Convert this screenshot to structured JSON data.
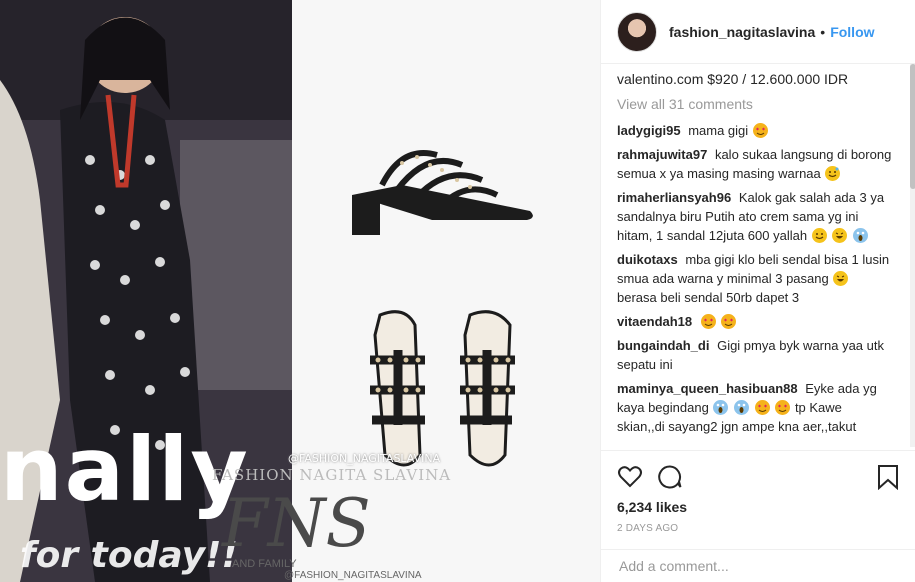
{
  "post": {
    "overlay_main": "nally",
    "overlay_bottom": "for today!!",
    "watermark_handle": "@FASHION_NAGITASLAVINA",
    "watermark_name": "FASHION NAGITA SLAVINA",
    "watermark_logo": "FNS",
    "watermark_family": "AND FAMILY",
    "watermark_handle2": "@FASHION_NAGITASLAVINA"
  },
  "header": {
    "username": "fashion_nagitaslavina",
    "separator": "•",
    "follow_label": "Follow"
  },
  "caption": "valentino.com $920 / 12.600.000 IDR",
  "view_all": "View all 31 comments",
  "comments": [
    {
      "user": "ladygigi95",
      "text": "mama gigi"
    },
    {
      "user": "rahmajuwita97",
      "text": "kalo sukaa langsung di borong semua x ya masing masing warnaa"
    },
    {
      "user": "rimaherliansyah96",
      "text": "Kalok gak salah ada 3 ya sandalnya biru Putih ato crem sama yg ini hitam, 1 sandal 12juta 600 yallah"
    },
    {
      "user": "duikotaxs",
      "text": "mba gigi klo beli sendal bisa 1 lusin smua ada warna y minimal 3 pasang",
      "text2": "berasa beli sendal 50rb dapet 3"
    },
    {
      "user": "vitaendah18",
      "text": ""
    },
    {
      "user": "bungaindah_di",
      "text": "Gigi pmya byk warna yaa utk sepatu ini"
    },
    {
      "user": "maminya_queen_hasibuan88",
      "text": "Eyke ada yg kaya begindang",
      "text2": "tp Kawe skian,,di sayang2 jgn ampe kna aer,,takut"
    }
  ],
  "likes": "6,234 likes",
  "time": "2 DAYS AGO",
  "add_comment_placeholder": "Add a comment...",
  "icons": {
    "like": "heart-icon",
    "comment": "comment-icon",
    "save": "bookmark-icon"
  },
  "colors": {
    "follow": "#3897f0",
    "emoji_heart_eyes": "#f5b21b",
    "emoji_heart": "#e0245e"
  }
}
